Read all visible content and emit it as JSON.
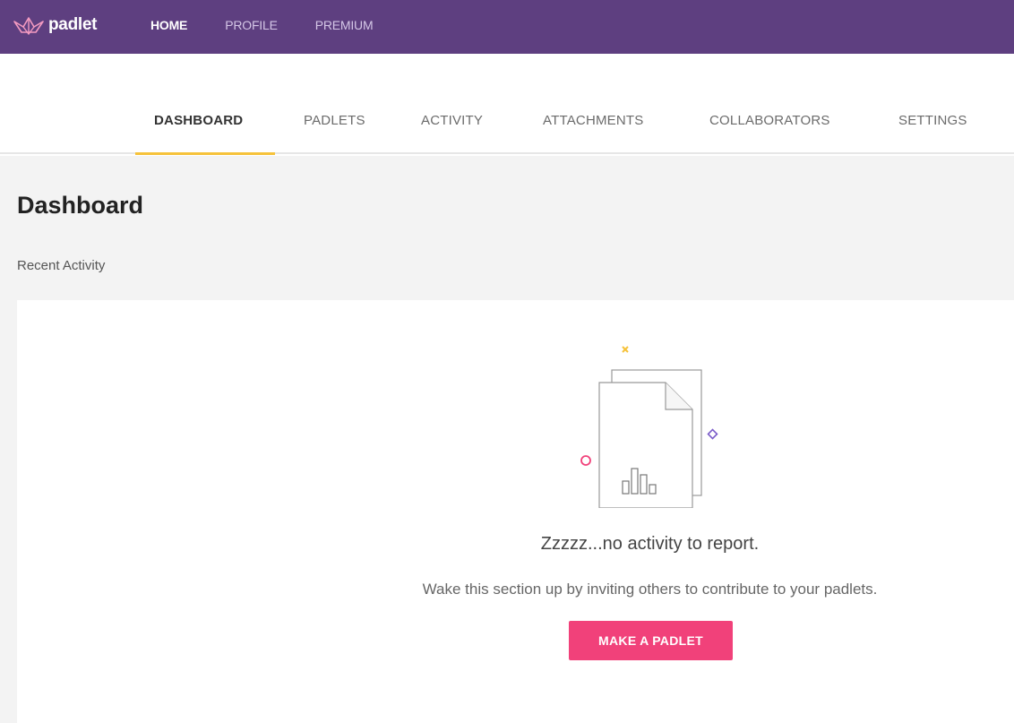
{
  "brand": {
    "name": "padlet"
  },
  "topnav": [
    {
      "label": "HOME",
      "active": true
    },
    {
      "label": "PROFILE",
      "active": false
    },
    {
      "label": "PREMIUM",
      "active": false
    }
  ],
  "tabs": [
    {
      "label": "DASHBOARD",
      "active": true
    },
    {
      "label": "PADLETS",
      "active": false
    },
    {
      "label": "ACTIVITY",
      "active": false
    },
    {
      "label": "ATTACHMENTS",
      "active": false
    },
    {
      "label": "COLLABORATORS",
      "active": false
    },
    {
      "label": "SETTINGS",
      "active": false
    }
  ],
  "page": {
    "title": "Dashboard",
    "section_label": "Recent Activity"
  },
  "empty_state": {
    "title": "Zzzzz...no activity to report.",
    "subtitle": "Wake this section up by inviting others to contribute to your padlets.",
    "cta_label": "MAKE A PADLET"
  },
  "colors": {
    "topbar": "#5e3f80",
    "tab_underline": "#f6c23a",
    "cta": "#f1417a",
    "content_bg": "#f3f3f3"
  }
}
